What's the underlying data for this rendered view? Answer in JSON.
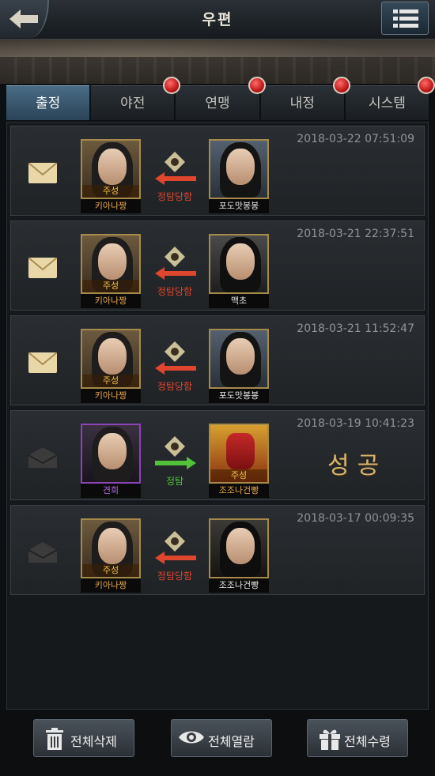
{
  "header": {
    "title": "우편"
  },
  "tabs": [
    {
      "label": "출정",
      "active": true,
      "badge": false
    },
    {
      "label": "야전",
      "active": false,
      "badge": true
    },
    {
      "label": "연맹",
      "active": false,
      "badge": true
    },
    {
      "label": "내정",
      "active": false,
      "badge": true
    },
    {
      "label": "시스템",
      "active": false,
      "badge": true
    }
  ],
  "mails": [
    {
      "time": "2018-03-22 07:51:09",
      "read": false,
      "left": {
        "role": "주성",
        "name": "키아나짱"
      },
      "action": "정탐당함",
      "right": {
        "role": "",
        "name": "포도맛봉봉"
      },
      "result": ""
    },
    {
      "time": "2018-03-21 22:37:51",
      "read": false,
      "left": {
        "role": "주성",
        "name": "키아나짱"
      },
      "action": "정탐당함",
      "right": {
        "role": "",
        "name": "맥초"
      },
      "result": ""
    },
    {
      "time": "2018-03-21 11:52:47",
      "read": false,
      "left": {
        "role": "주성",
        "name": "키아나짱"
      },
      "action": "정탐당함",
      "right": {
        "role": "",
        "name": "포도맛봉봉"
      },
      "result": ""
    },
    {
      "time": "2018-03-19 10:41:23",
      "read": true,
      "left": {
        "role": "",
        "name": "견희"
      },
      "action": "정탐",
      "right": {
        "role": "주성",
        "name": "조조나건빵"
      },
      "result": "성공"
    },
    {
      "time": "2018-03-17 00:09:35",
      "read": true,
      "left": {
        "role": "주성",
        "name": "키아나짱"
      },
      "action": "정탐당함",
      "right": {
        "role": "",
        "name": "조조나건빵"
      },
      "result": ""
    }
  ],
  "footer": {
    "delete_all": "전체삭제",
    "read_all": "전체열람",
    "receive_all": "전체수령"
  },
  "colors": {
    "tab_active": "#3d5c74",
    "badge_red": "#c01818",
    "action_red": "#e0452e",
    "action_green": "#52c23a",
    "portrait_gold": "#a58a4a",
    "portrait_purple": "#8b43b8"
  }
}
